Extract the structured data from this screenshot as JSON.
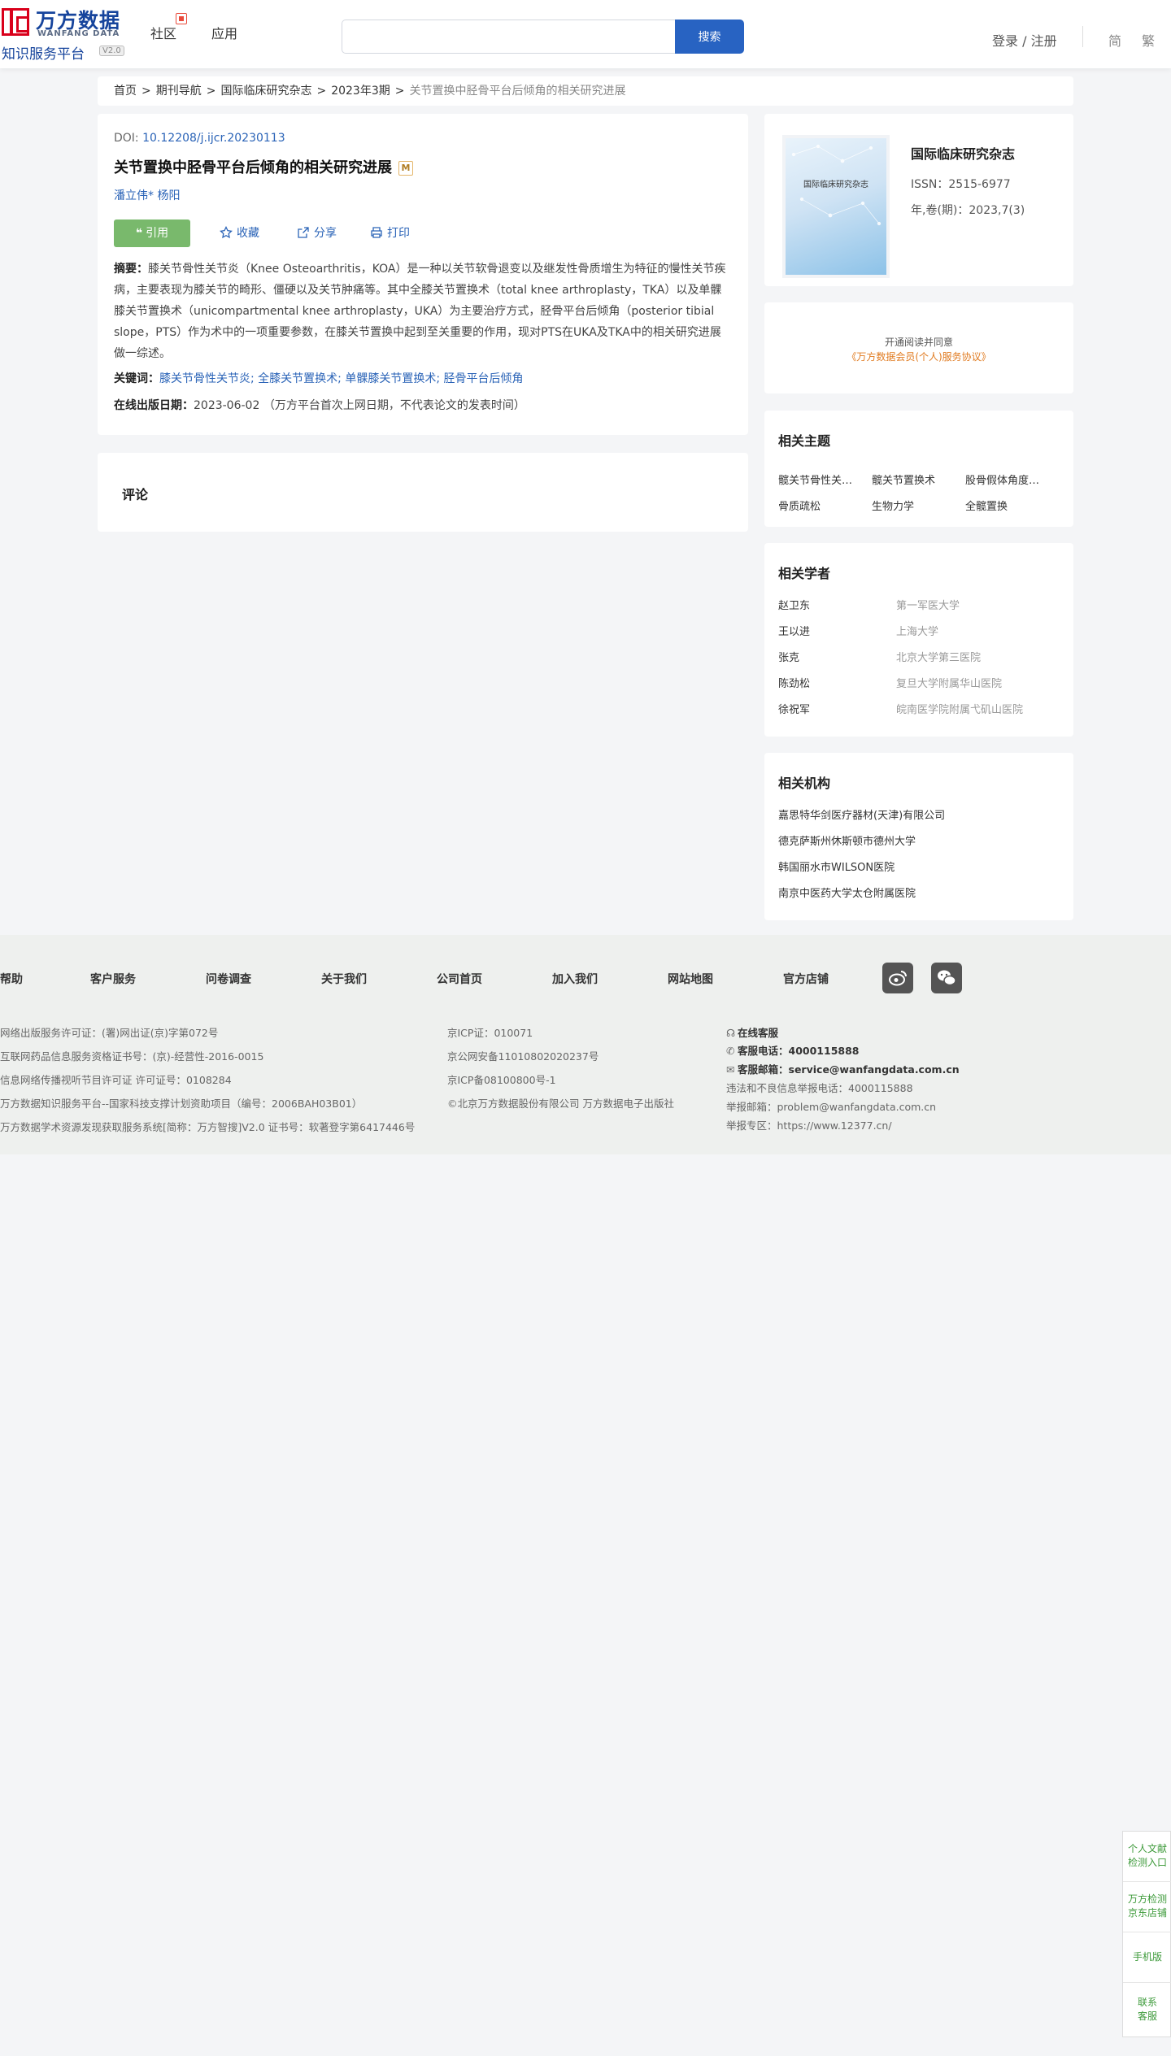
{
  "header": {
    "logo_cn": "万方数据",
    "logo_en": "WANFANG DATA",
    "logo_sub": "知识服务平台",
    "logo_version": "V2.0",
    "nav": [
      "社区",
      "应用"
    ],
    "search_placeholder": "",
    "search_button": "搜索",
    "login": "登录 / 注册",
    "lang_simplified": "简",
    "lang_traditional": "繁"
  },
  "breadcrumb": {
    "items": [
      "首页",
      "期刊导航",
      "国际临床研究杂志",
      "2023年3期"
    ],
    "separator": ">",
    "current": "关节置换中胫骨平台后倾角的相关研究进展"
  },
  "article": {
    "doi_label": "DOI: ",
    "doi": "10.12208/j.ijcr.20230113",
    "title": "关节置换中胫骨平台后倾角的相关研究进展",
    "badge": "M",
    "authors": [
      "潘立伟*",
      "杨阳"
    ],
    "actions": {
      "cite": "引用",
      "favorite": "收藏",
      "share": "分享",
      "print": "打印"
    },
    "abstract_label": "摘要：",
    "abstract": "膝关节骨性关节炎（Knee Osteoarthritis，KOA）是一种以关节软骨退变以及继发性骨质增生为特征的慢性关节疾病，主要表现为膝关节的畸形、僵硬以及关节肿痛等。其中全膝关节置换术（total knee arthroplasty，TKA）以及单髁膝关节置换术（unicompartmental knee arthroplasty，UKA）为主要治疗方式，胫骨平台后倾角（posterior tibial slope，PTS）作为术中的一项重要参数，在膝关节置换中起到至关重要的作用，现对PTS在UKA及TKA中的相关研究进展做一综述。",
    "keywords_label": "关键词：",
    "keywords": [
      "膝关节骨性关节炎",
      "全膝关节置换术",
      "单髁膝关节置换术",
      "胫骨平台后倾角"
    ],
    "pubdate_label": "在线出版日期：",
    "pubdate": "2023-06-02",
    "pubdate_note": "（万方平台首次上网日期，不代表论文的发表时间）"
  },
  "comments": {
    "title": "评论"
  },
  "journal": {
    "cover_text": "国际临床研究杂志",
    "name": "国际临床研究杂志",
    "issn": "ISSN：2515-6977",
    "year_issue": "年,卷(期)：2023,7(3)"
  },
  "agreement": {
    "line1": "开通阅读并同意",
    "line2": "《万方数据会员(个人)服务协议》"
  },
  "topics": {
    "title": "相关主题",
    "items": [
      "髋关节骨性关节炎",
      "髋关节置换术",
      "股骨假体角度测量",
      "骨质疏松",
      "生物力学",
      "全髋置换"
    ]
  },
  "scholars": {
    "title": "相关学者",
    "items": [
      {
        "name": "赵卫东",
        "org": "第一军医大学"
      },
      {
        "name": "王以进",
        "org": "上海大学"
      },
      {
        "name": "张克",
        "org": "北京大学第三医院"
      },
      {
        "name": "陈劲松",
        "org": "复旦大学附属华山医院"
      },
      {
        "name": "徐祝军",
        "org": "皖南医学院附属弋矶山医院"
      }
    ]
  },
  "institutions": {
    "title": "相关机构",
    "items": [
      "嘉思特华剑医疗器材(天津)有限公司",
      "德克萨斯州休斯顿市德州大学",
      "韩国丽水市WILSON医院",
      "南京中医药大学太仓附属医院"
    ]
  },
  "footer": {
    "links": [
      "帮助",
      "客户服务",
      "问卷调查",
      "关于我们",
      "公司首页",
      "加入我们",
      "网站地图",
      "官方店铺"
    ],
    "col1": [
      "网络出版服务许可证：(署)网出证(京)字第072号",
      "互联网药品信息服务资格证书号：(京)-经营性-2016-0015",
      "信息网络传播视听节目许可证 许可证号：0108284",
      "万方数据知识服务平台--国家科技支撑计划资助项目（编号：2006BAH03B01）",
      "万方数据学术资源发现获取服务系统[简称：万方智搜]V2.0 证书号：软著登字第6417446号"
    ],
    "col2": [
      "京ICP证：010071",
      "京公网安备11010802020237号",
      "京ICP备08100800号-1",
      "©北京万方数据股份有限公司 万方数据电子出版社"
    ],
    "online_service": "在线客服",
    "phone_label": "客服电话：",
    "phone": "4000115888",
    "email_label": "客服邮箱：",
    "email": "service@wanfangdata.com.cn",
    "report_phone": "违法和不良信息举报电话：4000115888",
    "report_email": "举报邮箱：problem@wanfangdata.com.cn",
    "report_site": "举报专区：https://www.12377.cn/"
  },
  "float_panel": [
    [
      "个人文献",
      "检测入口"
    ],
    [
      "万方检测",
      "京东店铺"
    ],
    [
      "手机版"
    ],
    [
      "联系",
      "客服"
    ]
  ]
}
